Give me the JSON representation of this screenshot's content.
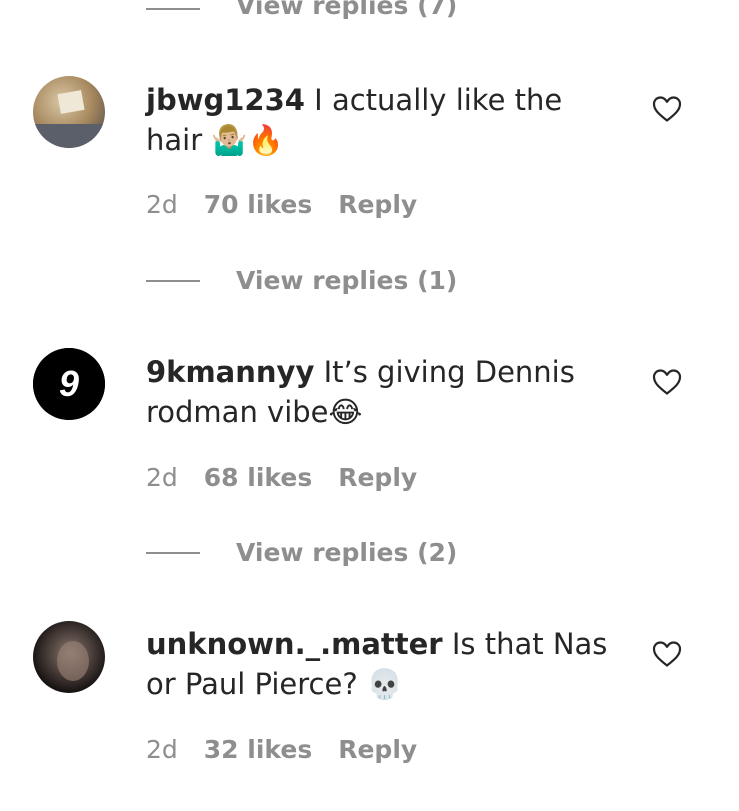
{
  "comments": [
    {
      "username": "jbwg1234",
      "text": " I actually like the hair 🤷🏼‍♂️🔥",
      "time": "2d",
      "likes": "70 likes",
      "reply": "Reply",
      "view_replies": "View replies (1)"
    },
    {
      "username": "9kmannyy",
      "text": " It’s giving Dennis rodman vibe😂",
      "time": "2d",
      "likes": "68 likes",
      "reply": "Reply",
      "view_replies": "View replies (2)",
      "avatar_letter": "9"
    },
    {
      "username": "unknown._.matter",
      "text": " Is that Nas or Paul Pierce? 💀",
      "time": "2d",
      "likes": "32 likes",
      "reply": "Reply"
    }
  ],
  "top_view_replies": "View replies (7)",
  "colors": {
    "text": "#262626",
    "muted": "#8e8e8e",
    "background": "#ffffff"
  },
  "icons": {
    "like": "heart-outline-icon"
  }
}
